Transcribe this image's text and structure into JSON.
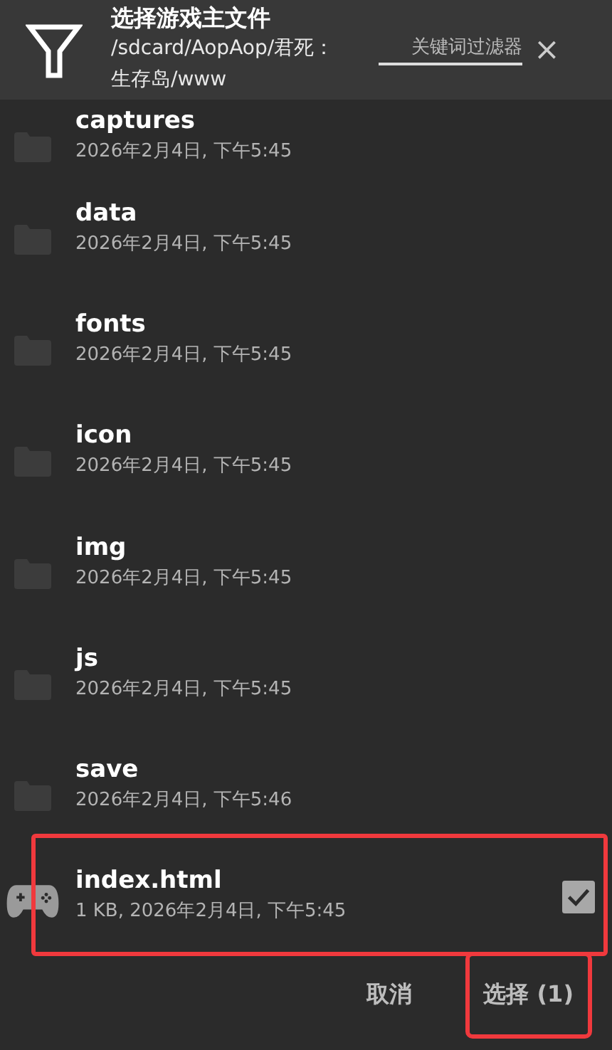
{
  "header": {
    "title": "选择游戏主文件",
    "path": "/sdcard/AopAop/君死：生存岛/www",
    "filter": {
      "placeholder": "关键词过滤器"
    },
    "close": "×"
  },
  "files": [
    {
      "kind": "folder",
      "name": "captures",
      "meta": "2026年2月4日, 下午5:45",
      "checked": false,
      "highlighted": false
    },
    {
      "kind": "folder",
      "name": "data",
      "meta": "2026年2月4日, 下午5:45",
      "checked": false,
      "highlighted": false
    },
    {
      "kind": "folder",
      "name": "fonts",
      "meta": "2026年2月4日, 下午5:45",
      "checked": false,
      "highlighted": false
    },
    {
      "kind": "folder",
      "name": "icon",
      "meta": "2026年2月4日, 下午5:45",
      "checked": false,
      "highlighted": false
    },
    {
      "kind": "folder",
      "name": "img",
      "meta": "2026年2月4日, 下午5:45",
      "checked": false,
      "highlighted": false
    },
    {
      "kind": "folder",
      "name": "js",
      "meta": "2026年2月4日, 下午5:45",
      "checked": false,
      "highlighted": false
    },
    {
      "kind": "folder",
      "name": "save",
      "meta": "2026年2月4日, 下午5:46",
      "checked": false,
      "highlighted": false
    },
    {
      "kind": "game",
      "name": "index.html",
      "meta": "1 KB, 2026年2月4日, 下午5:45",
      "checked": true,
      "highlighted": true
    }
  ],
  "buttons": [
    {
      "label": "取消",
      "highlighted": false
    },
    {
      "label": "选择 (1)",
      "highlighted": true
    }
  ]
}
